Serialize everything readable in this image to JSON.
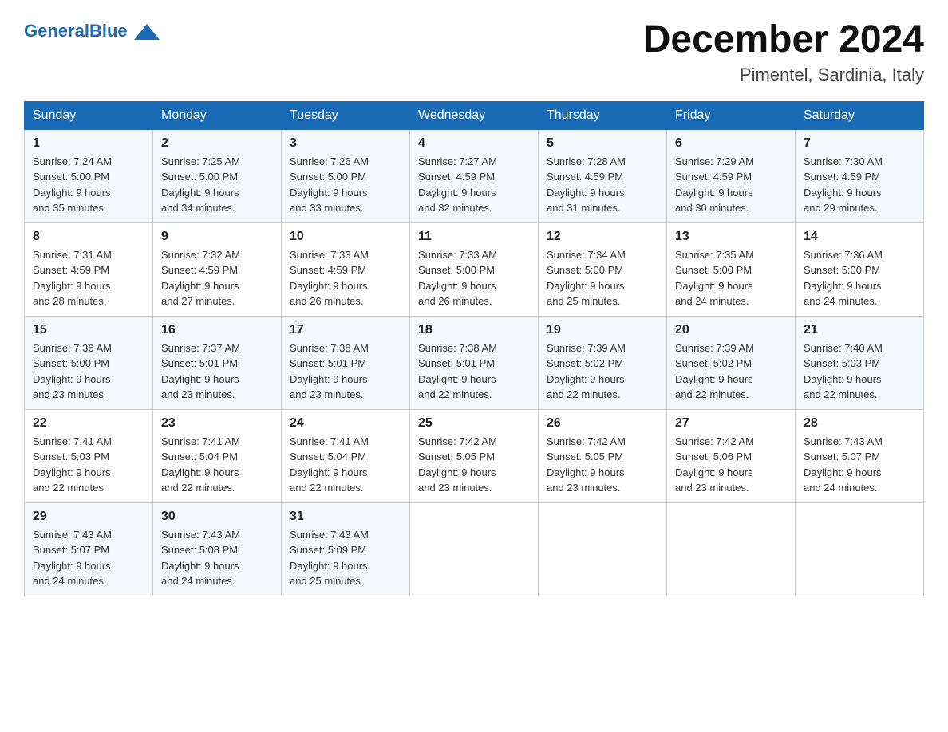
{
  "header": {
    "logo_text_black": "General",
    "logo_text_blue": "Blue",
    "month_title": "December 2024",
    "location": "Pimentel, Sardinia, Italy"
  },
  "days_of_week": [
    "Sunday",
    "Monday",
    "Tuesday",
    "Wednesday",
    "Thursday",
    "Friday",
    "Saturday"
  ],
  "weeks": [
    [
      {
        "day": "1",
        "sunrise": "7:24 AM",
        "sunset": "5:00 PM",
        "daylight": "9 hours and 35 minutes."
      },
      {
        "day": "2",
        "sunrise": "7:25 AM",
        "sunset": "5:00 PM",
        "daylight": "9 hours and 34 minutes."
      },
      {
        "day": "3",
        "sunrise": "7:26 AM",
        "sunset": "5:00 PM",
        "daylight": "9 hours and 33 minutes."
      },
      {
        "day": "4",
        "sunrise": "7:27 AM",
        "sunset": "4:59 PM",
        "daylight": "9 hours and 32 minutes."
      },
      {
        "day": "5",
        "sunrise": "7:28 AM",
        "sunset": "4:59 PM",
        "daylight": "9 hours and 31 minutes."
      },
      {
        "day": "6",
        "sunrise": "7:29 AM",
        "sunset": "4:59 PM",
        "daylight": "9 hours and 30 minutes."
      },
      {
        "day": "7",
        "sunrise": "7:30 AM",
        "sunset": "4:59 PM",
        "daylight": "9 hours and 29 minutes."
      }
    ],
    [
      {
        "day": "8",
        "sunrise": "7:31 AM",
        "sunset": "4:59 PM",
        "daylight": "9 hours and 28 minutes."
      },
      {
        "day": "9",
        "sunrise": "7:32 AM",
        "sunset": "4:59 PM",
        "daylight": "9 hours and 27 minutes."
      },
      {
        "day": "10",
        "sunrise": "7:33 AM",
        "sunset": "4:59 PM",
        "daylight": "9 hours and 26 minutes."
      },
      {
        "day": "11",
        "sunrise": "7:33 AM",
        "sunset": "5:00 PM",
        "daylight": "9 hours and 26 minutes."
      },
      {
        "day": "12",
        "sunrise": "7:34 AM",
        "sunset": "5:00 PM",
        "daylight": "9 hours and 25 minutes."
      },
      {
        "day": "13",
        "sunrise": "7:35 AM",
        "sunset": "5:00 PM",
        "daylight": "9 hours and 24 minutes."
      },
      {
        "day": "14",
        "sunrise": "7:36 AM",
        "sunset": "5:00 PM",
        "daylight": "9 hours and 24 minutes."
      }
    ],
    [
      {
        "day": "15",
        "sunrise": "7:36 AM",
        "sunset": "5:00 PM",
        "daylight": "9 hours and 23 minutes."
      },
      {
        "day": "16",
        "sunrise": "7:37 AM",
        "sunset": "5:01 PM",
        "daylight": "9 hours and 23 minutes."
      },
      {
        "day": "17",
        "sunrise": "7:38 AM",
        "sunset": "5:01 PM",
        "daylight": "9 hours and 23 minutes."
      },
      {
        "day": "18",
        "sunrise": "7:38 AM",
        "sunset": "5:01 PM",
        "daylight": "9 hours and 22 minutes."
      },
      {
        "day": "19",
        "sunrise": "7:39 AM",
        "sunset": "5:02 PM",
        "daylight": "9 hours and 22 minutes."
      },
      {
        "day": "20",
        "sunrise": "7:39 AM",
        "sunset": "5:02 PM",
        "daylight": "9 hours and 22 minutes."
      },
      {
        "day": "21",
        "sunrise": "7:40 AM",
        "sunset": "5:03 PM",
        "daylight": "9 hours and 22 minutes."
      }
    ],
    [
      {
        "day": "22",
        "sunrise": "7:41 AM",
        "sunset": "5:03 PM",
        "daylight": "9 hours and 22 minutes."
      },
      {
        "day": "23",
        "sunrise": "7:41 AM",
        "sunset": "5:04 PM",
        "daylight": "9 hours and 22 minutes."
      },
      {
        "day": "24",
        "sunrise": "7:41 AM",
        "sunset": "5:04 PM",
        "daylight": "9 hours and 22 minutes."
      },
      {
        "day": "25",
        "sunrise": "7:42 AM",
        "sunset": "5:05 PM",
        "daylight": "9 hours and 23 minutes."
      },
      {
        "day": "26",
        "sunrise": "7:42 AM",
        "sunset": "5:05 PM",
        "daylight": "9 hours and 23 minutes."
      },
      {
        "day": "27",
        "sunrise": "7:42 AM",
        "sunset": "5:06 PM",
        "daylight": "9 hours and 23 minutes."
      },
      {
        "day": "28",
        "sunrise": "7:43 AM",
        "sunset": "5:07 PM",
        "daylight": "9 hours and 24 minutes."
      }
    ],
    [
      {
        "day": "29",
        "sunrise": "7:43 AM",
        "sunset": "5:07 PM",
        "daylight": "9 hours and 24 minutes."
      },
      {
        "day": "30",
        "sunrise": "7:43 AM",
        "sunset": "5:08 PM",
        "daylight": "9 hours and 24 minutes."
      },
      {
        "day": "31",
        "sunrise": "7:43 AM",
        "sunset": "5:09 PM",
        "daylight": "9 hours and 25 minutes."
      },
      null,
      null,
      null,
      null
    ]
  ],
  "labels": {
    "sunrise": "Sunrise:",
    "sunset": "Sunset:",
    "daylight": "Daylight:"
  }
}
